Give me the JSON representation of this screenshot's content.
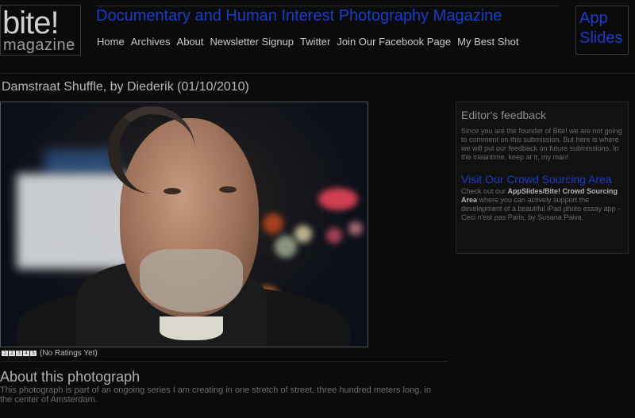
{
  "logo": {
    "main": "bite!",
    "sub": "magazine"
  },
  "site_title": "Documentary and Human Interest Photography Magazine",
  "nav": [
    {
      "label": "Home"
    },
    {
      "label": "Archives"
    },
    {
      "label": "About"
    },
    {
      "label": "Newsletter Signup"
    },
    {
      "label": "Twitter"
    },
    {
      "label": "Join Our Facebook Page"
    },
    {
      "label": "My Best Shot"
    }
  ],
  "app_box": {
    "line1": "App",
    "line2": "Slides"
  },
  "photo": {
    "title": "Damstraat Shuffle, by Diederik (01/10/2010)"
  },
  "rating": {
    "stars": [
      "1",
      "2",
      "3",
      "4",
      "5"
    ],
    "text": "(No Ratings Yet)"
  },
  "about": {
    "title": "About this photograph",
    "text": "This photograph is part of an ongoing series I am creating in one stretch of street, three hundred meters long, in the center of Amsterdam."
  },
  "sidebar": {
    "feedback_title": "Editor's feedback",
    "feedback_text": "Since you are the founder of Bite! we are not going to comment on this submission. But here is where we will put our feedback on future submissions. In the meantime, keep at it, my man!",
    "crowd_link": "Visit Our Crowd Sourcing Area",
    "crowd_text_before": "Check out our ",
    "crowd_text_bold": "AppSlides/Bite! Crowd Sourcing Area",
    "crowd_text_after": " where you can actively support the development of a beautiful iPad photo essay app - Ceci n'est pas Paris, by Susana Paiva."
  },
  "colors": {
    "accent_blue": "#1b3cc9",
    "background": "#0b0b0b"
  }
}
